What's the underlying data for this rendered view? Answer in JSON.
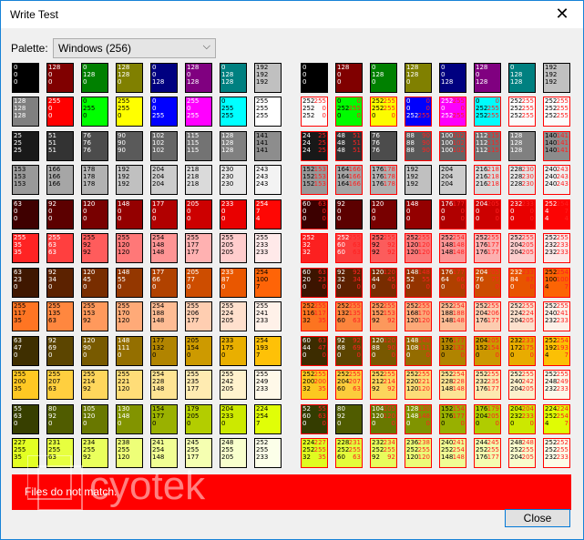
{
  "window": {
    "title": "Write Test"
  },
  "palette": {
    "label": "Palette:",
    "selected": "Windows (256)"
  },
  "error_message": "Files do not match.",
  "close_label": "Close",
  "watermark": "cyotek",
  "rows": [
    [
      [
        "0",
        "0",
        "0"
      ],
      [
        "128",
        "0",
        "0"
      ],
      [
        "0",
        "128",
        "0"
      ],
      [
        "128",
        "128",
        "0"
      ],
      [
        "0",
        "0",
        "128"
      ],
      [
        "128",
        "0",
        "128"
      ],
      [
        "0",
        "128",
        "128"
      ],
      [
        "192",
        "192",
        "192"
      ]
    ],
    [
      [
        "128",
        "128",
        "128"
      ],
      [
        "255",
        "0",
        "0"
      ],
      [
        "0",
        "255",
        "0"
      ],
      [
        "255",
        "255",
        "0"
      ],
      [
        "0",
        "0",
        "255"
      ],
      [
        "255",
        "0",
        "255"
      ],
      [
        "0",
        "255",
        "255"
      ],
      [
        "255",
        "255",
        "255"
      ]
    ],
    [
      [
        "25",
        "25",
        "25"
      ],
      [
        "51",
        "51",
        "51"
      ],
      [
        "76",
        "76",
        "76"
      ],
      [
        "90",
        "90",
        "90"
      ],
      [
        "102",
        "102",
        "102"
      ],
      [
        "115",
        "115",
        "115"
      ],
      [
        "128",
        "128",
        "128"
      ],
      [
        "141",
        "141",
        "141"
      ]
    ],
    [
      [
        "153",
        "153",
        "153"
      ],
      [
        "166",
        "166",
        "166"
      ],
      [
        "178",
        "178",
        "178"
      ],
      [
        "192",
        "192",
        "192"
      ],
      [
        "204",
        "204",
        "204"
      ],
      [
        "218",
        "218",
        "218"
      ],
      [
        "230",
        "230",
        "230"
      ],
      [
        "243",
        "243",
        "243"
      ]
    ],
    [
      [
        "63",
        "0",
        "0"
      ],
      [
        "92",
        "0",
        "0"
      ],
      [
        "120",
        "0",
        "0"
      ],
      [
        "148",
        "0",
        "0"
      ],
      [
        "177",
        "0",
        "0"
      ],
      [
        "205",
        "0",
        "0"
      ],
      [
        "233",
        "0",
        "0"
      ],
      [
        "254",
        "7",
        "4"
      ]
    ],
    [
      [
        "255",
        "35",
        "35"
      ],
      [
        "255",
        "63",
        "63"
      ],
      [
        "255",
        "92",
        "92"
      ],
      [
        "255",
        "120",
        "120"
      ],
      [
        "254",
        "148",
        "148"
      ],
      [
        "255",
        "177",
        "177"
      ],
      [
        "255",
        "205",
        "205"
      ],
      [
        "255",
        "233",
        "233"
      ]
    ],
    [
      [
        "63",
        "23",
        "0"
      ],
      [
        "92",
        "34",
        "0"
      ],
      [
        "120",
        "45",
        "0"
      ],
      [
        "148",
        "55",
        "0"
      ],
      [
        "177",
        "66",
        "0"
      ],
      [
        "205",
        "77",
        "0"
      ],
      [
        "233",
        "87",
        "0"
      ],
      [
        "254",
        "100",
        "7"
      ]
    ],
    [
      [
        "255",
        "117",
        "35"
      ],
      [
        "255",
        "135",
        "63"
      ],
      [
        "255",
        "153",
        "92"
      ],
      [
        "255",
        "170",
        "120"
      ],
      [
        "254",
        "188",
        "148"
      ],
      [
        "255",
        "206",
        "177"
      ],
      [
        "255",
        "224",
        "205"
      ],
      [
        "255",
        "241",
        "233"
      ]
    ],
    [
      [
        "63",
        "47",
        "0"
      ],
      [
        "92",
        "69",
        "0"
      ],
      [
        "120",
        "90",
        "0"
      ],
      [
        "148",
        "111",
        "0"
      ],
      [
        "177",
        "132",
        "0"
      ],
      [
        "205",
        "154",
        "0"
      ],
      [
        "233",
        "175",
        "0"
      ],
      [
        "254",
        "193",
        "7"
      ]
    ],
    [
      [
        "255",
        "200",
        "35"
      ],
      [
        "255",
        "207",
        "63"
      ],
      [
        "255",
        "214",
        "92"
      ],
      [
        "255",
        "221",
        "120"
      ],
      [
        "254",
        "228",
        "148"
      ],
      [
        "255",
        "235",
        "177"
      ],
      [
        "255",
        "242",
        "205"
      ],
      [
        "255",
        "249",
        "233"
      ]
    ],
    [
      [
        "55",
        "63",
        "0"
      ],
      [
        "80",
        "92",
        "0"
      ],
      [
        "105",
        "120",
        "0"
      ],
      [
        "130",
        "148",
        "0"
      ],
      [
        "154",
        "177",
        "0"
      ],
      [
        "179",
        "205",
        "0"
      ],
      [
        "204",
        "233",
        "0"
      ],
      [
        "224",
        "254",
        "7"
      ]
    ],
    [
      [
        "227",
        "255",
        "35"
      ],
      [
        "231",
        "255",
        "63"
      ],
      [
        "234",
        "255",
        "92"
      ],
      [
        "238",
        "255",
        "120"
      ],
      [
        "241",
        "254",
        "148"
      ],
      [
        "245",
        "255",
        "177"
      ],
      [
        "248",
        "255",
        "205"
      ],
      [
        "252",
        "255",
        "233"
      ]
    ]
  ],
  "rows_right": [
    [
      [
        "0",
        "0",
        "0"
      ],
      [
        "128",
        "0",
        "0"
      ],
      [
        "0",
        "128",
        "0"
      ],
      [
        "128",
        "128",
        "0"
      ],
      [
        "0",
        "0",
        "128"
      ],
      [
        "128",
        "0",
        "128"
      ],
      [
        "0",
        "128",
        "128"
      ],
      [
        "192",
        "192",
        "192"
      ]
    ],
    [
      [
        "252",
        "252",
        "252",
        "255",
        "0",
        "0"
      ],
      [
        "0",
        "252",
        "0",
        "0",
        "255",
        "0"
      ],
      [
        "252",
        "252",
        "0",
        "255",
        "255",
        "0"
      ],
      [
        "0",
        "0",
        "252",
        "0",
        "0",
        "255"
      ],
      [
        "252",
        "0",
        "252",
        "255",
        "0",
        "255"
      ],
      [
        "0",
        "252",
        "252",
        "0",
        "255",
        "255"
      ],
      [
        "252",
        "252",
        "252",
        "255",
        "255",
        "255"
      ],
      [
        "252",
        "252",
        "252",
        "255",
        "255",
        "255"
      ]
    ],
    [
      [
        "24",
        "24",
        "24",
        "25",
        "25",
        "25"
      ],
      [
        "48",
        "48",
        "48",
        "51",
        "51",
        "51"
      ],
      [
        "76",
        "76",
        "76"
      ],
      [
        "88",
        "88",
        "88",
        "90",
        "90",
        "90"
      ],
      [
        "100",
        "100",
        "100",
        "102",
        "102",
        "102"
      ],
      [
        "112",
        "112",
        "112",
        "115",
        "115",
        "115"
      ],
      [
        "128",
        "128",
        "128"
      ],
      [
        "140",
        "140",
        "140",
        "141",
        "141",
        "141"
      ]
    ],
    [
      [
        "152",
        "152",
        "152",
        "153",
        "153",
        "153"
      ],
      [
        "164",
        "164",
        "164",
        "166",
        "166",
        "166"
      ],
      [
        "176",
        "176",
        "176",
        "178",
        "178",
        "178"
      ],
      [
        "192",
        "192",
        "192"
      ],
      [
        "204",
        "204",
        "204"
      ],
      [
        "216",
        "216",
        "216",
        "218",
        "218",
        "218"
      ],
      [
        "228",
        "228",
        "228",
        "230",
        "230",
        "230"
      ],
      [
        "240",
        "240",
        "240",
        "243",
        "243",
        "243"
      ]
    ],
    [
      [
        "60",
        "0",
        "0",
        "63",
        "0",
        "0"
      ],
      [
        "92",
        "0",
        "0"
      ],
      [
        "120",
        "0",
        "0"
      ],
      [
        "148",
        "0",
        "0"
      ],
      [
        "176",
        "0",
        "0",
        "177",
        "0",
        "0"
      ],
      [
        "204",
        "0",
        "0",
        "205",
        "0",
        "0"
      ],
      [
        "232",
        "0",
        "0",
        "233",
        "0",
        "0"
      ],
      [
        "252",
        "4",
        "4",
        "254",
        "7",
        "4"
      ]
    ],
    [
      [
        "252",
        "32",
        "32",
        "255",
        "35",
        "35"
      ],
      [
        "252",
        "60",
        "60",
        "255",
        "63",
        "63"
      ],
      [
        "252",
        "92",
        "92",
        "255",
        "92",
        "92"
      ],
      [
        "252",
        "120",
        "120",
        "255",
        "120",
        "120"
      ],
      [
        "252",
        "148",
        "148",
        "254",
        "148",
        "148"
      ],
      [
        "252",
        "176",
        "176",
        "255",
        "177",
        "177"
      ],
      [
        "252",
        "204",
        "204",
        "255",
        "205",
        "205"
      ],
      [
        "252",
        "232",
        "232",
        "255",
        "233",
        "233"
      ]
    ],
    [
      [
        "60",
        "20",
        "0",
        "63",
        "23",
        "0"
      ],
      [
        "92",
        "32",
        "0",
        "92",
        "34",
        "0"
      ],
      [
        "120",
        "44",
        "0",
        "120",
        "45",
        "0"
      ],
      [
        "148",
        "52",
        "0",
        "148",
        "55",
        "0"
      ],
      [
        "176",
        "64",
        "0",
        "177",
        "66",
        "0"
      ],
      [
        "204",
        "76",
        "0",
        "205",
        "77",
        "0"
      ],
      [
        "232",
        "84",
        "0",
        "233",
        "87",
        "0"
      ],
      [
        "252",
        "100",
        "4",
        "254",
        "100",
        "7"
      ]
    ],
    [
      [
        "252",
        "116",
        "32",
        "255",
        "117",
        "35"
      ],
      [
        "252",
        "132",
        "60",
        "255",
        "135",
        "63"
      ],
      [
        "252",
        "152",
        "92",
        "255",
        "153",
        "92"
      ],
      [
        "252",
        "168",
        "120",
        "255",
        "170",
        "120"
      ],
      [
        "252",
        "188",
        "148",
        "254",
        "188",
        "148"
      ],
      [
        "252",
        "204",
        "176",
        "255",
        "206",
        "177"
      ],
      [
        "252",
        "224",
        "204",
        "255",
        "224",
        "205"
      ],
      [
        "252",
        "240",
        "232",
        "255",
        "241",
        "233"
      ]
    ],
    [
      [
        "60",
        "44",
        "0",
        "63",
        "47",
        "0"
      ],
      [
        "92",
        "68",
        "0",
        "92",
        "69",
        "0"
      ],
      [
        "120",
        "88",
        "0",
        "120",
        "90",
        "0"
      ],
      [
        "148",
        "108",
        "0",
        "148",
        "111",
        "0"
      ],
      [
        "176",
        "132",
        "0",
        "177",
        "132",
        "0"
      ],
      [
        "204",
        "152",
        "0",
        "205",
        "154",
        "0"
      ],
      [
        "232",
        "172",
        "0",
        "233",
        "175",
        "0"
      ],
      [
        "252",
        "192",
        "4",
        "254",
        "193",
        "7"
      ]
    ],
    [
      [
        "252",
        "200",
        "32",
        "255",
        "200",
        "35"
      ],
      [
        "252",
        "204",
        "60",
        "255",
        "207",
        "63"
      ],
      [
        "252",
        "212",
        "92",
        "255",
        "214",
        "92"
      ],
      [
        "252",
        "220",
        "120",
        "255",
        "221",
        "120"
      ],
      [
        "252",
        "228",
        "148",
        "254",
        "228",
        "148"
      ],
      [
        "252",
        "232",
        "176",
        "255",
        "235",
        "177"
      ],
      [
        "252",
        "240",
        "204",
        "255",
        "242",
        "205"
      ],
      [
        "252",
        "248",
        "232",
        "255",
        "249",
        "233"
      ]
    ],
    [
      [
        "52",
        "60",
        "0",
        "55",
        "63",
        "0"
      ],
      [
        "80",
        "92",
        "0"
      ],
      [
        "104",
        "120",
        "0",
        "105",
        "120",
        "0"
      ],
      [
        "128",
        "148",
        "0",
        "130",
        "148",
        "0"
      ],
      [
        "152",
        "176",
        "0",
        "154",
        "177",
        "0"
      ],
      [
        "176",
        "204",
        "0",
        "179",
        "205",
        "0"
      ],
      [
        "204",
        "232",
        "0",
        "204",
        "233",
        "0"
      ],
      [
        "224",
        "252",
        "4",
        "224",
        "254",
        "7"
      ]
    ],
    [
      [
        "224",
        "252",
        "32",
        "227",
        "255",
        "35"
      ],
      [
        "228",
        "252",
        "60",
        "231",
        "255",
        "63"
      ],
      [
        "232",
        "252",
        "92",
        "234",
        "255",
        "92"
      ],
      [
        "236",
        "252",
        "120",
        "238",
        "255",
        "120"
      ],
      [
        "240",
        "252",
        "148",
        "241",
        "254",
        "148"
      ],
      [
        "244",
        "252",
        "176",
        "245",
        "255",
        "177"
      ],
      [
        "248",
        "252",
        "204",
        "248",
        "255",
        "205"
      ],
      [
        "252",
        "252",
        "232",
        "252",
        "255",
        "233"
      ]
    ]
  ]
}
